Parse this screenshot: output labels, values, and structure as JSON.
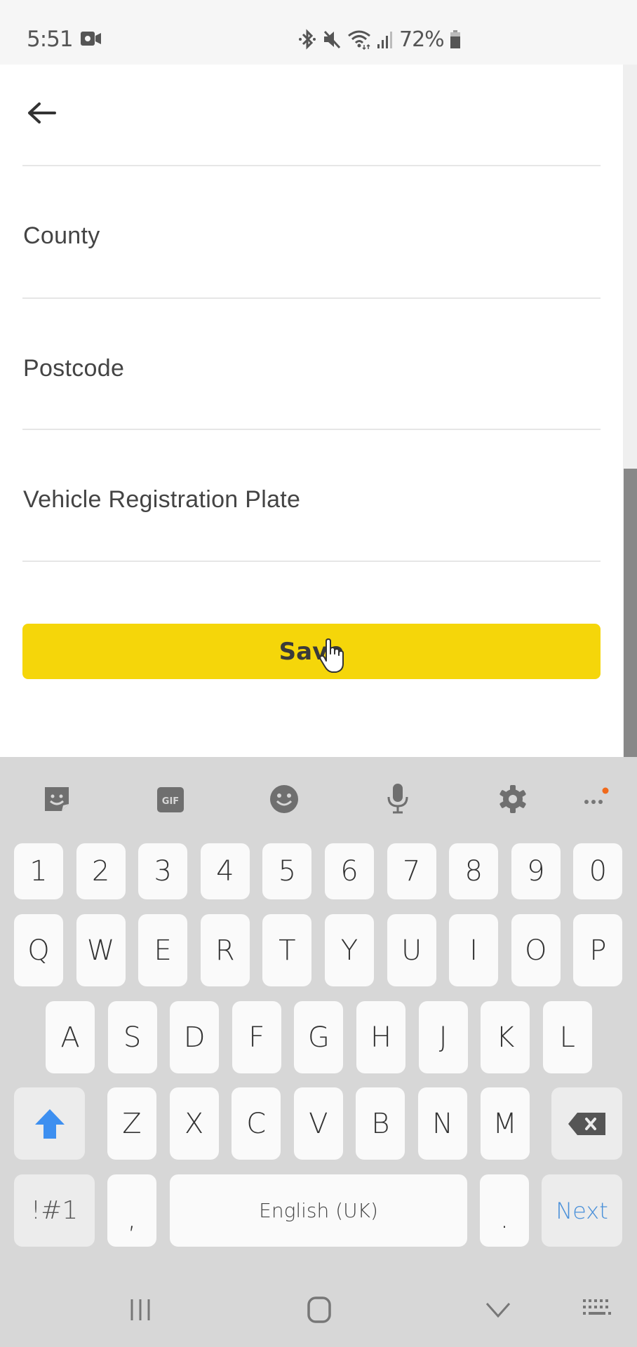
{
  "status_bar": {
    "time": "5:51",
    "battery_percent": "72%",
    "icons": [
      "screen-record-icon",
      "bluetooth-icon",
      "mute-icon",
      "wifi-icon",
      "signal-icon",
      "battery-icon"
    ]
  },
  "app": {
    "back_icon": "arrow-left-icon",
    "fields": [
      {
        "label": "County",
        "value": ""
      },
      {
        "label": "Postcode",
        "value": ""
      },
      {
        "label": "Vehicle Registration Plate",
        "value": ""
      }
    ],
    "save_label": "Save",
    "accent_color": "#f5d60a"
  },
  "keyboard": {
    "toolbar": [
      "sticker-icon",
      "gif-icon",
      "emoji-icon",
      "microphone-icon",
      "settings-gear-icon",
      "more-options-icon"
    ],
    "gif_label": "GIF",
    "rows": [
      [
        "1",
        "2",
        "3",
        "4",
        "5",
        "6",
        "7",
        "8",
        "9",
        "0"
      ],
      [
        "Q",
        "W",
        "E",
        "R",
        "T",
        "Y",
        "U",
        "I",
        "O",
        "P"
      ],
      [
        "A",
        "S",
        "D",
        "F",
        "G",
        "H",
        "J",
        "K",
        "L"
      ],
      [
        "Z",
        "X",
        "C",
        "V",
        "B",
        "N",
        "M"
      ]
    ],
    "symbols_label": "!#1",
    "comma_label": ",",
    "space_label": "English (UK)",
    "period_label": ".",
    "action_label": "Next",
    "action_color": "#4a90d9",
    "shift_color": "#3d8ff0"
  },
  "nav_bar": {
    "icons": [
      "recent-apps-icon",
      "home-icon",
      "hide-keyboard-icon",
      "keyboard-switch-icon"
    ]
  }
}
